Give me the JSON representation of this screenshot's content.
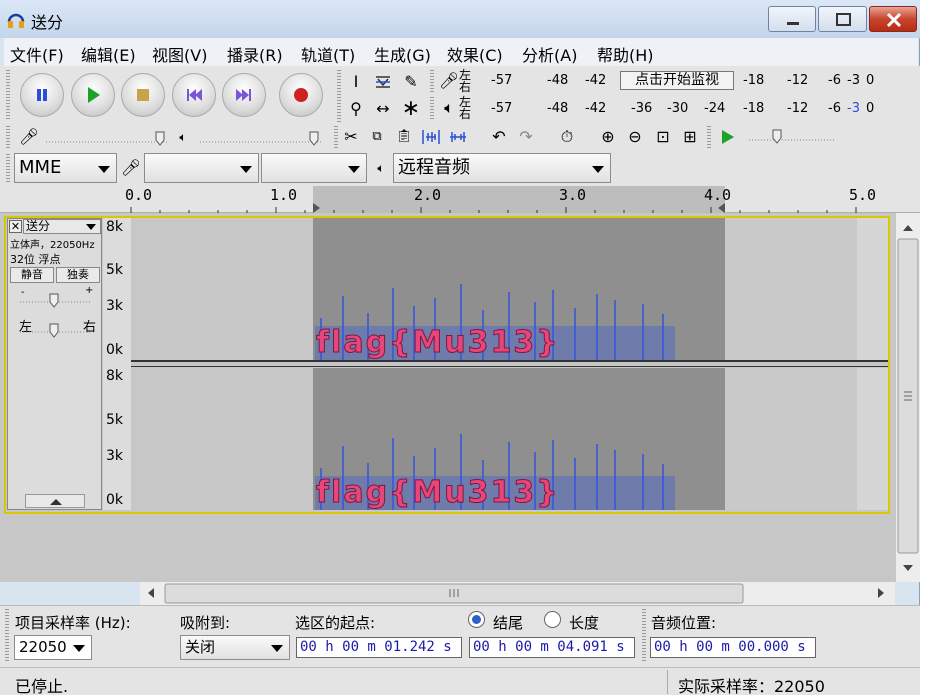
{
  "window": {
    "title": "送分"
  },
  "menu": [
    "文件(F)",
    "编辑(E)",
    "视图(V)",
    "播录(R)",
    "轨道(T)",
    "生成(G)",
    "效果(C)",
    "分析(A)",
    "帮助(H)"
  ],
  "meters": {
    "rec_label": "左右",
    "play_label": "左右",
    "rec_ticks": [
      "-57",
      "-48",
      "-42",
      "-18",
      "-12",
      "-6",
      "-3",
      "0"
    ],
    "play_ticks": [
      "-57",
      "-48",
      "-42",
      "-36",
      "-30",
      "-24",
      "-18",
      "-12",
      "-6",
      "-3",
      "0"
    ],
    "monitor_button": "点击开始监视"
  },
  "device": {
    "host": "MME",
    "rec_device": "",
    "rec_channels": "",
    "play_device": "远程音频"
  },
  "ruler": [
    "0.0",
    "1.0",
    "2.0",
    "3.0",
    "4.0",
    "5.0"
  ],
  "track": {
    "name": "送分",
    "info": "立体声，22050Hz",
    "format": "32位 浮点",
    "mute": "静音",
    "solo": "独奏",
    "pan_left": "左",
    "pan_right": "右",
    "gain_minus": "-",
    "gain_plus": "+",
    "scale": [
      "8k",
      "5k",
      "3k",
      "0k"
    ],
    "hidden_text": "flag{Mu313}"
  },
  "bottom": {
    "rate_label": "项目采样率 (Hz):",
    "rate_value": "22050",
    "snap_label": "吸附到:",
    "snap_value": "关闭",
    "sel_start_label": "选区的起点:",
    "end_label": "结尾",
    "length_label": "长度",
    "audio_pos_label": "音频位置:",
    "sel_start": "00 h 00 m 01.242 s",
    "sel_end": "00 h 00 m 04.091 s",
    "audio_pos": "00 h 00 m 00.000 s"
  },
  "status": {
    "left": "已停止.",
    "right": "实际采样率：22050"
  },
  "colors": {
    "selection": "#8f8f8f",
    "waveform_bg": "#c9c9c9",
    "text_fill": "#e8457a",
    "spectrum": "#3355dd"
  }
}
